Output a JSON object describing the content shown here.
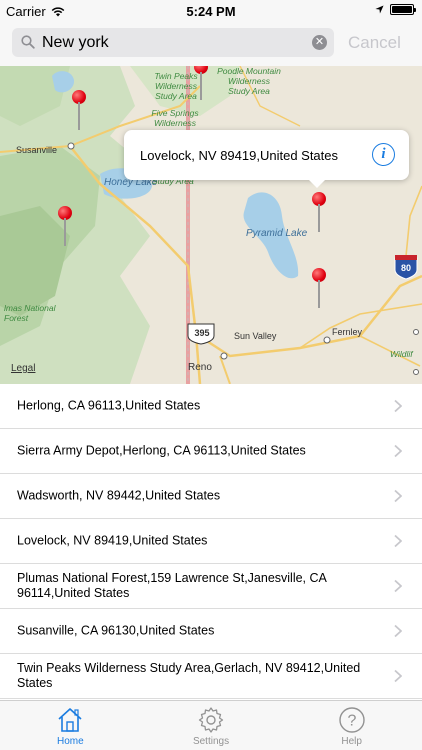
{
  "status_bar": {
    "carrier": "Carrier",
    "time": "5:24 PM",
    "battery_level": 1.0
  },
  "search": {
    "value": "New york",
    "placeholder": "",
    "cancel_label": "Cancel"
  },
  "map": {
    "labels": {
      "susanville": "Susanville",
      "honey_lake": "Honey Lake",
      "pyramid_lake": "Pyramid Lake",
      "sun_valley": "Sun Valley",
      "reno": "Reno",
      "fernley": "Fernley",
      "wildlife": "Wildlif",
      "plumas": "lmas National Forest",
      "twin_peaks": "Twin Peaks Wilderness Study Area",
      "five_springs": "Five Springs Wilderness",
      "poodle_mountain": "Poodle Mountain Wilderness Study Area",
      "study_area_partial": "Study Area",
      "highway_395": "395",
      "interstate_80": "80",
      "legal": "Legal"
    },
    "callout_text": "Lovelock, NV  89419,United States",
    "icons": {
      "info": "info-icon",
      "pin": "map-pin-icon"
    }
  },
  "results": [
    "Herlong, CA  96113,United States",
    "Sierra Army Depot,Herlong, CA  96113,United States",
    "Wadsworth, NV  89442,United States",
    "Lovelock, NV  89419,United States",
    "Plumas National Forest,159 Lawrence St,Janesville, CA  96114,United States",
    "Susanville, CA  96130,United States",
    "Twin Peaks Wilderness Study Area,Gerlach, NV  89412,United States"
  ],
  "tabs": [
    {
      "label": "Home",
      "icon": "home-icon",
      "active": true
    },
    {
      "label": "Settings",
      "icon": "gear-icon",
      "active": false
    },
    {
      "label": "Help",
      "icon": "help-icon",
      "active": false
    }
  ],
  "colors": {
    "accent": "#1a7ce0",
    "pin": "#e00010",
    "inactive_tab": "#929292",
    "cancel_disabled": "#c7c7cc"
  }
}
